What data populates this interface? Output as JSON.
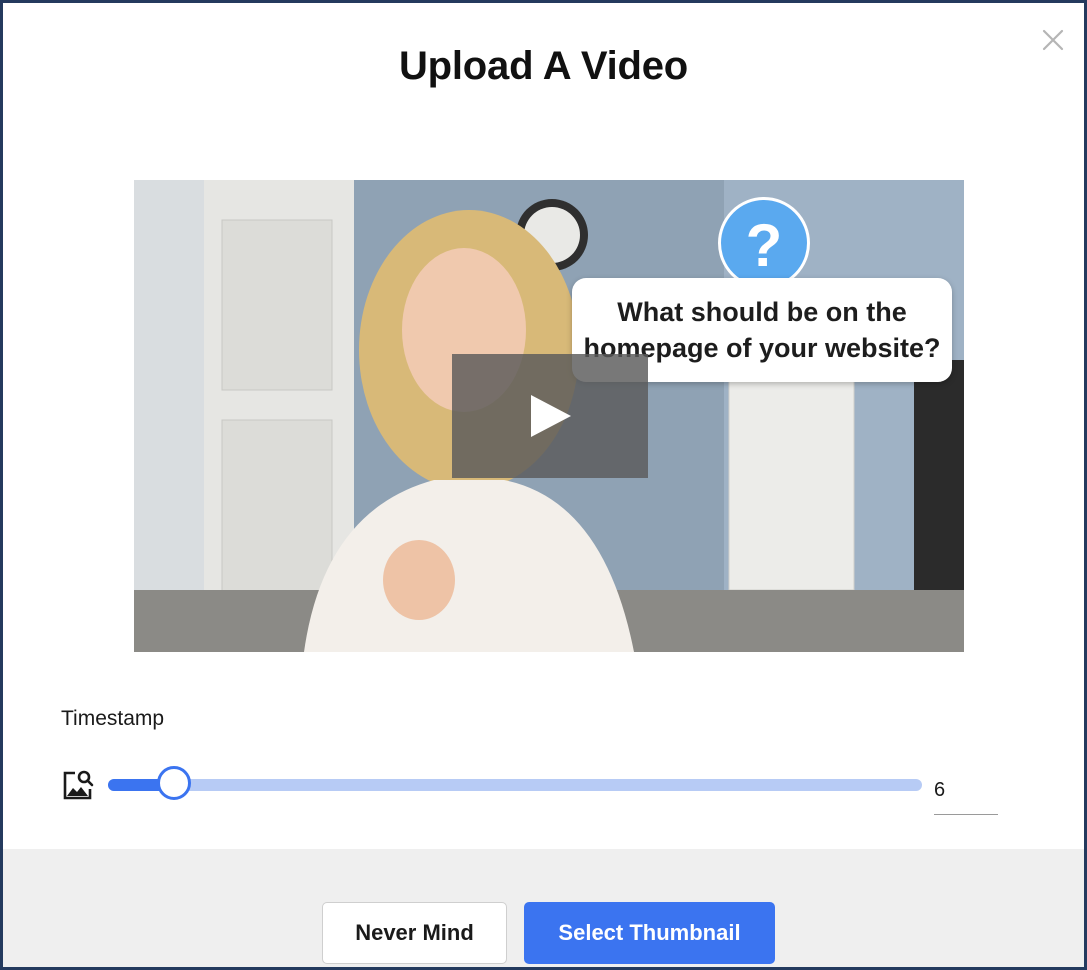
{
  "dialog": {
    "title": "Upload A Video",
    "close_icon": "close-icon"
  },
  "video": {
    "overlay_question_mark": "?",
    "overlay_caption": "What should be on the homepage of your website?",
    "play_icon": "play-icon"
  },
  "timestamp": {
    "label": "Timestamp",
    "value": "6",
    "slider_position": 0.08,
    "thumbnail_icon": "image-search-icon"
  },
  "footer": {
    "cancel_label": "Never Mind",
    "confirm_label": "Select Thumbnail"
  },
  "colors": {
    "accent": "#3b74f0",
    "track": "#b7cbf5",
    "border": "#243a5e",
    "footer_bg": "#efefef"
  }
}
